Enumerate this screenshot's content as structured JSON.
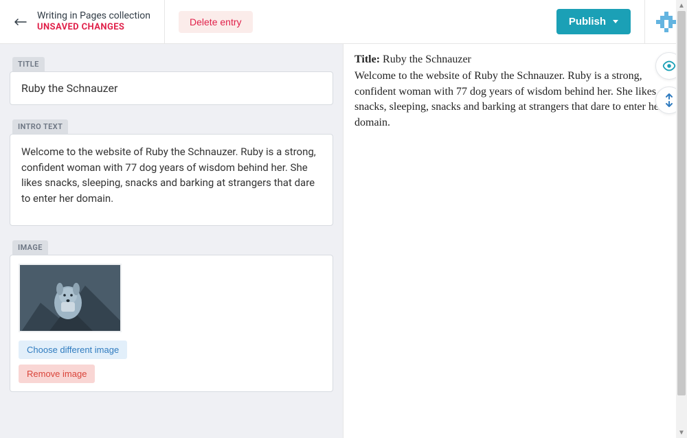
{
  "header": {
    "collection_text": "Writing in Pages collection",
    "unsaved_text": "UNSAVED CHANGES",
    "delete_label": "Delete entry",
    "publish_label": "Publish"
  },
  "fields": {
    "title": {
      "label": "TITLE",
      "value": "Ruby the Schnauzer"
    },
    "intro": {
      "label": "INTRO TEXT",
      "value": "Welcome to the website of Ruby the Schnauzer. Ruby is a strong, confident woman with 77 dog years of wisdom behind her. She likes snacks, sleeping, snacks and barking at strangers that dare to enter her domain."
    },
    "image": {
      "label": "IMAGE",
      "choose_label": "Choose different image",
      "remove_label": "Remove image"
    }
  },
  "preview": {
    "title_prefix": "Title:",
    "title_value": "Ruby the Schnauzer",
    "body": "Welcome to the website of Ruby the Schnauzer. Ruby is a strong, confident woman with 77 dog years of wisdom behind her. She likes snacks, sleeping, snacks and barking at strangers that dare to enter her domain."
  }
}
